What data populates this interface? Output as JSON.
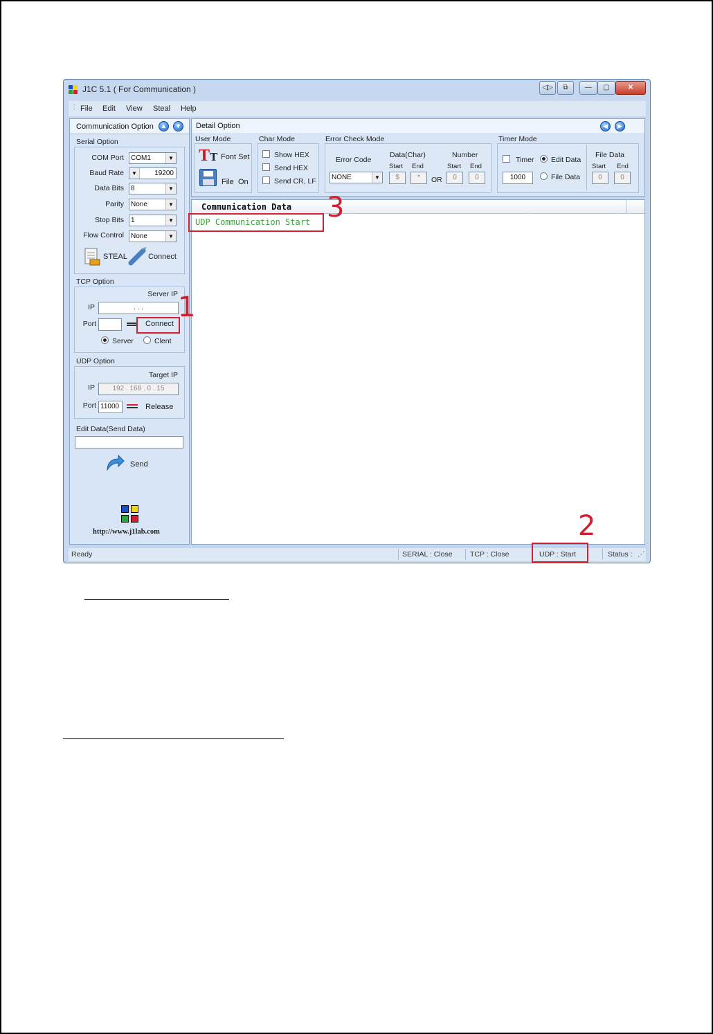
{
  "window": {
    "title": "J1C 5.1 ( For Communication )",
    "title_buttons": [
      "◁▷",
      "⧉",
      "—",
      "▢",
      "✕"
    ]
  },
  "menu": {
    "items": [
      "File",
      "Edit",
      "View",
      "Steal",
      "Help"
    ]
  },
  "left": {
    "header": "Communication Option",
    "serial": {
      "label": "Serial Option",
      "com_port_label": "COM Port",
      "com_port": "COM1",
      "baud_label": "Baud Rate",
      "baud": "19200",
      "data_bits_label": "Data Bits",
      "data_bits": "8",
      "parity_label": "Parity",
      "parity": "None",
      "stop_bits_label": "Stop Bits",
      "stop_bits": "1",
      "flow_label": "Flow Control",
      "flow": "None",
      "steal_label": "STEAL",
      "connect_label": "Connect"
    },
    "tcp": {
      "label": "TCP Option",
      "server_ip_label": "Server IP",
      "ip_label": "IP",
      "ip_value": ".       .       .",
      "port_label": "Port",
      "port_value": "",
      "connect_label": "Connect",
      "server_label": "Server",
      "client_label": "Clent"
    },
    "udp": {
      "label": "UDP Option",
      "target_ip_label": "Target IP",
      "ip_label": "IP",
      "ip_value": "192 . 168 .  0  .  15",
      "port_label": "Port",
      "port_value": "11000",
      "release_label": "Release"
    },
    "edit": {
      "label": "Edit Data(Send Data)",
      "value": "",
      "send_label": "Send"
    },
    "website": "http://www.j1lab.com"
  },
  "detail": {
    "header": "Detail Option",
    "user_mode": {
      "label": "User Mode",
      "font_set": "Font Set",
      "file": "File",
      "on": "On"
    },
    "char_mode": {
      "label": "Char Mode",
      "show_hex": "Show HEX",
      "send_hex": "Send HEX",
      "send_crlf": "Send CR, LF"
    },
    "error_check": {
      "label": "Error Check Mode",
      "error_code_label": "Error Code",
      "error_code": "NONE",
      "data_char_label": "Data(Char)",
      "number_label": "Number",
      "start": "Start",
      "end": "End",
      "or": "OR",
      "start_char": "$",
      "end_char": "*",
      "start_num": "0",
      "end_num": "0"
    },
    "timer": {
      "label": "Timer Mode",
      "timer_label": "Timer",
      "timer_value": "1000",
      "edit_data": "Edit Data",
      "file_data": "File Data",
      "file_data_label": "File Data",
      "start": "Start",
      "end": "End",
      "start_value": "0",
      "end_value": "0"
    }
  },
  "comm": {
    "header": "Communication Data",
    "line": "UDP Communication Start"
  },
  "status": {
    "ready": "Ready",
    "serial": "SERIAL : Close",
    "tcp": "TCP : Close",
    "udp": "UDP : Start",
    "status": "Status :"
  },
  "annotations": {
    "one": "1",
    "two": "2",
    "three": "3"
  },
  "colors": {
    "annotation": "#d21f2f",
    "comm_text": "#40a040"
  }
}
